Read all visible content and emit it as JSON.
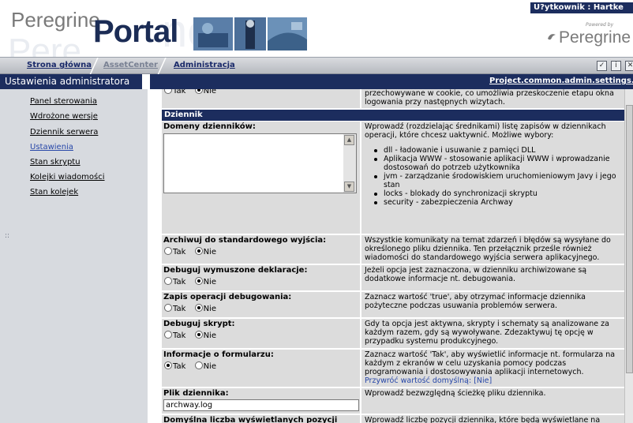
{
  "header": {
    "logo_peregrine": "Peregrine",
    "logo_portal": "Portal",
    "user_label": "U?ytkownik : Hartke",
    "powered_by": "Powered by",
    "brand": "Peregrine"
  },
  "nav": {
    "tabs": [
      {
        "label": "Strona główna"
      },
      {
        "label": "AssetCenter"
      },
      {
        "label": "Administracja"
      }
    ],
    "icons": [
      "check-icon",
      "info-icon",
      "close-icon"
    ]
  },
  "titlebar": {
    "title": "Ustawienia administratora",
    "right_link": "Project.common.admin.settings.start"
  },
  "sidebar": {
    "items": [
      {
        "label": "Panel sterowania"
      },
      {
        "label": "Wdrożone wersje"
      },
      {
        "label": "Dziennik serwera"
      },
      {
        "label": "Ustawienia"
      },
      {
        "label": "Stan skryptu"
      },
      {
        "label": "Kolejki wiadomości"
      },
      {
        "label": "Stan kolejek"
      }
    ],
    "active_bullet": "::"
  },
  "content": {
    "top_row": {
      "radio_yes": "Tak",
      "radio_no": "Nie",
      "desc": "przechowywane w cookie, co umożliwia przeskoczenie etapu okna logowania przy następnych wizytach."
    },
    "section_title": "Dziennik",
    "domains": {
      "label": "Domeny dzienników:",
      "desc": "Wprowadź (rozdzielając średnikami) listę zapisów w dziennikach operacji, które chcesz uaktywnić. Możliwe wybory:",
      "options": [
        "dll - ładowanie i usuwanie z pamięci DLL",
        "Aplikacja WWW - stosowanie aplikacji WWW i wprowadzanie dostosowań do potrzeb użytkownika",
        "jvm - zarządzanie środowiskiem uruchomieniowym Javy i jego stan",
        "locks - blokady do synchronizacji skryptu",
        "security - zabezpieczenia Archway"
      ]
    },
    "archive": {
      "label": "Archiwuj do standardowego wyjścia:",
      "yes": "Tak",
      "no": "Nie",
      "desc": "Wszystkie komunikaty na temat zdarzeń i błędów są wysyłane do określonego pliku dziennika. Ten przełącznik prześle również wiadomości do standardowego wyjścia serwera aplikacyjnego."
    },
    "debug_decl": {
      "label": "Debuguj wymuszone deklaracje:",
      "yes": "Tak",
      "no": "Nie",
      "desc": "Jeżeli opcja jest zaznaczona, w dzienniku archiwizowane są dodatkowe informacje nt. debugowania."
    },
    "debug_ops": {
      "label": "Zapis operacji debugowania:",
      "yes": "Tak",
      "no": "Nie",
      "desc": "Zaznacz wartość 'true', aby otrzymać informacje dziennika pożyteczne podczas usuwania problemów serwera."
    },
    "debug_script": {
      "label": "Debuguj skrypt:",
      "yes": "Tak",
      "no": "Nie",
      "desc": "Gdy ta opcja jest aktywna, skrypty i schematy są analizowane za każdym razem, gdy są wywoływane. Zdezaktywuj tę opcję w przypadku systemu produkcyjnego."
    },
    "form_info": {
      "label": "Informacje o formularzu:",
      "yes": "Tak",
      "no": "Nie",
      "desc": "Zaznacz wartość 'Tak', aby wyświetlić informacje nt. formularza na każdym z ekranów w celu uzyskania pomocy podczas programowania i dostosowywania aplikacji internetowych.",
      "restore": "Przywróć wartość domyślną: [Nie]"
    },
    "log_file": {
      "label": "Plik dziennika:",
      "value": "archway.log",
      "desc": "Wprowadź bezwzględną ścieżkę pliku dziennika."
    },
    "default_count": {
      "label": "Domyślna liczba wyświetlanych pozycji dziennika:",
      "desc": "Wprowadź liczbę pozycji dziennika, które będą wyświetlane na każdej"
    }
  }
}
